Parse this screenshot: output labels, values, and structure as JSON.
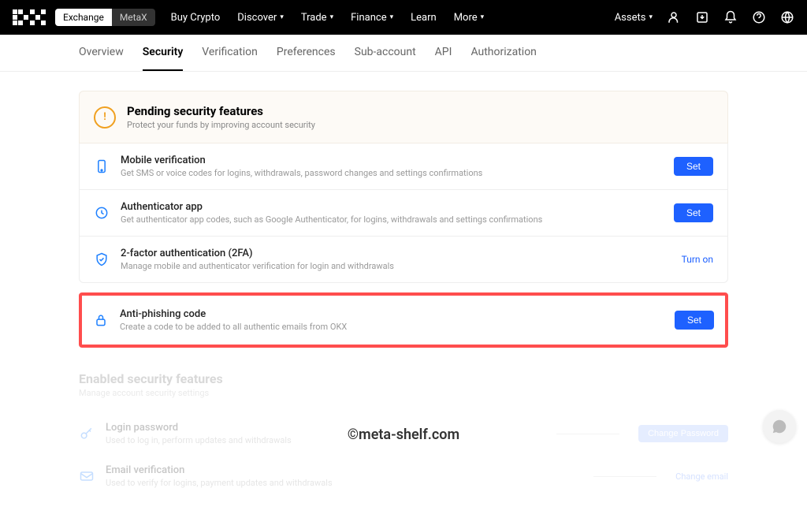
{
  "topnav": {
    "toggle": {
      "exchange": "Exchange",
      "metax": "MetaX"
    },
    "links": [
      "Buy Crypto",
      "Discover",
      "Trade",
      "Finance",
      "Learn",
      "More"
    ],
    "links_dropdown": [
      false,
      true,
      true,
      true,
      false,
      true
    ],
    "assets": "Assets"
  },
  "tabs": [
    "Overview",
    "Security",
    "Verification",
    "Preferences",
    "Sub-account",
    "API",
    "Authorization"
  ],
  "active_tab": 1,
  "pending": {
    "title": "Pending security features",
    "subtitle": "Protect your funds by improving account security",
    "items": [
      {
        "icon": "phone",
        "title": "Mobile verification",
        "desc": "Get SMS or voice codes for logins, withdrawals, password changes and settings confirmations",
        "action": "Set",
        "action_type": "button"
      },
      {
        "icon": "auth",
        "title": "Authenticator app",
        "desc": "Get authenticator app codes, such as Google Authenticator, for logins, withdrawals and settings confirmations",
        "action": "Set",
        "action_type": "button"
      },
      {
        "icon": "shield",
        "title": "2-factor authentication (2FA)",
        "desc": "Manage mobile and authenticator verification for login and withdrawals",
        "action": "Turn on",
        "action_type": "link"
      }
    ],
    "highlighted": {
      "icon": "lock",
      "title": "Anti-phishing code",
      "desc": "Create a code to be added to all authentic emails from OKX",
      "action": "Set",
      "action_type": "button"
    }
  },
  "enabled": {
    "title": "Enabled security features",
    "subtitle": "Manage account security settings",
    "items": [
      {
        "icon": "key",
        "title": "Login password",
        "desc": "Used to log in, perform updates and withdrawals",
        "action": "Change Password",
        "action_type": "button"
      },
      {
        "icon": "mail",
        "title": "Email verification",
        "desc": "Used to verify for logins, payment updates and withdrawals",
        "action": "Change email",
        "action_type": "link"
      }
    ]
  },
  "watermark": "©meta-shelf.com"
}
